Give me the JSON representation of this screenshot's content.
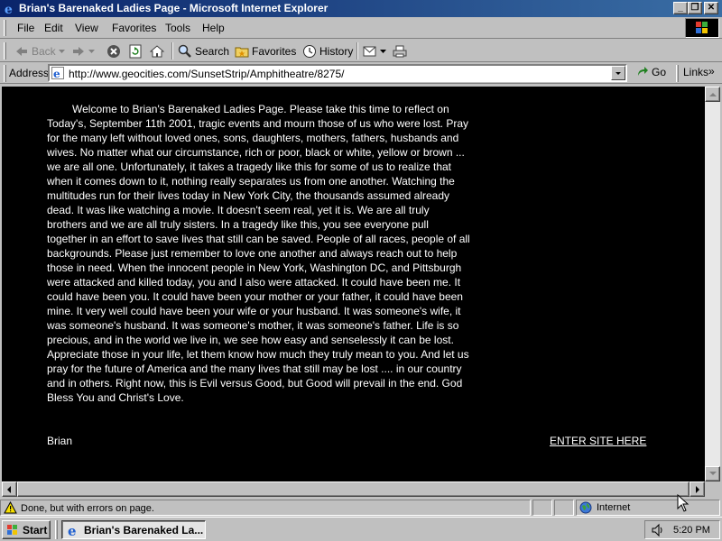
{
  "window": {
    "title": "Brian's Barenaked Ladies Page - Microsoft Internet Explorer",
    "minimize_glyph": "_",
    "maximize_glyph": "❐",
    "close_glyph": "✕"
  },
  "menu": {
    "items": [
      {
        "label": "File"
      },
      {
        "label": "Edit"
      },
      {
        "label": "View"
      },
      {
        "label": "Favorites"
      },
      {
        "label": "Tools"
      },
      {
        "label": "Help"
      }
    ]
  },
  "toolbar": {
    "back_label": "Back",
    "search_label": "Search",
    "favorites_label": "Favorites",
    "history_label": "History"
  },
  "address": {
    "label": "Address",
    "url": "http://www.geocities.com/SunsetStrip/Amphitheatre/8275/",
    "go_label": "Go",
    "links_label": "Links"
  },
  "page": {
    "message": "Welcome to Brian's Barenaked Ladies Page. Please take this time to reflect on Today's, September 11th 2001, tragic events and mourn those of us who were lost. Pray for the many left without loved ones, sons, daughters, mothers, fathers, husbands and wives. No matter what our circumstance, rich or poor, black or white, yellow or brown ... we are all one. Unfortunately, it takes a tragedy like this for some of us to realize that when it comes down to it, nothing really separates us from one another. Watching the multitudes run for their lives today in New York City, the thousands assumed already dead. It was like watching a movie. It doesn't seem real, yet it is. We are all truly brothers and we are all truly sisters. In a tragedy like this, you see everyone pull together in an effort to save lives that still can be saved. People of all races, people of all backgrounds. Please just remember to love one another and always reach out to help those in need. When the innocent people in New York, Washington DC, and Pittsburgh were attacked and killed today, you and I also were attacked. It could have been me. It could have been you. It could have been your mother or your father, it could have been mine. It very well could have been your wife or your husband. It was someone's wife, it was someone's husband. It was someone's mother, it was someone's father. Life is so precious, and in the world we live in, we see how easy and senselessly it can be lost. Appreciate those in your life, let them know how much they truly mean to you. And let us pray for the future of America and the many lives that still may be lost .... in our country and in others. Right now, this is Evil versus Good, but Good will prevail in the end. God Bless You and Christ's Love.",
    "signature": "Brian",
    "enter_link": "ENTER SITE HERE"
  },
  "status": {
    "text": "Done, but with errors on page.",
    "zone": "Internet"
  },
  "taskbar": {
    "start_label": "Start",
    "task_label": "Brian's Barenaked La...",
    "clock": "5:20 PM"
  },
  "colors": {
    "page_background": "#000000",
    "page_text": "#ffffff",
    "titlebar_start": "#0a246a",
    "titlebar_end": "#3a6ea5",
    "chrome": "#c0c0c0"
  }
}
